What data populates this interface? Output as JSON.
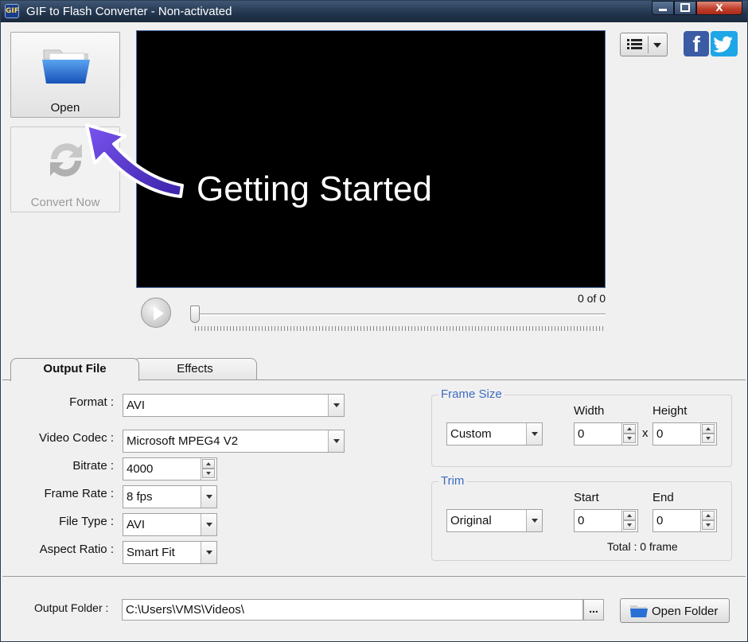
{
  "window": {
    "title": "GIF to Flash Converter - Non-activated",
    "icon_text": "GIF",
    "controls": [
      "minimize",
      "maximize",
      "close"
    ],
    "close_glyph": "X"
  },
  "toolbar": {
    "open_label": "Open",
    "convert_label": "Convert Now"
  },
  "preview": {
    "overlay_text": "Getting Started",
    "frame_counter": "0 of 0"
  },
  "social": {
    "facebook_glyph": "f"
  },
  "tabs": [
    {
      "label": "Output File",
      "active": true
    },
    {
      "label": "Effects",
      "active": false
    }
  ],
  "output_file": {
    "format": {
      "label": "Format :",
      "value": "AVI"
    },
    "video_codec": {
      "label": "Video Codec :",
      "value": "Microsoft MPEG4 V2"
    },
    "bitrate": {
      "label": "Bitrate :",
      "value": "4000"
    },
    "frame_rate": {
      "label": "Frame Rate :",
      "value": "8 fps"
    },
    "file_type": {
      "label": "File Type :",
      "value": "AVI"
    },
    "aspect_ratio": {
      "label": "Aspect Ratio :",
      "value": "Smart Fit"
    }
  },
  "frame_size": {
    "title": "Frame Size",
    "mode": "Custom",
    "width_label": "Width",
    "height_label": "Height",
    "width": "0",
    "height": "0",
    "separator": "x"
  },
  "trim": {
    "title": "Trim",
    "mode": "Original",
    "start_label": "Start",
    "end_label": "End",
    "start": "0",
    "end": "0",
    "total": "Total : 0 frame"
  },
  "output_folder": {
    "label": "Output Folder :",
    "path": "C:\\Users\\VMS\\Videos\\",
    "browse_label": "...",
    "open_folder_label": "Open Folder"
  },
  "colors": {
    "accent_blue": "#3c6bc2",
    "arrow_purple": "#5a2fd0",
    "facebook": "#3b5ba4",
    "twitter": "#1ea6e6"
  }
}
